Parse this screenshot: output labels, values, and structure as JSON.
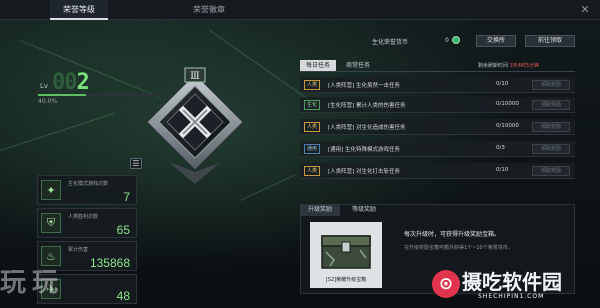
{
  "tabs": [
    {
      "label": "荣誉等级",
      "active": true
    },
    {
      "label": "荣誉徽章",
      "active": false
    }
  ],
  "level": {
    "prefix": "Lv",
    "value_dim": "00",
    "value_current": "2",
    "progress_text": "40.0%",
    "progress": 0.4
  },
  "stats": [
    {
      "label": "生化模式游戏次数",
      "value": "7",
      "icon": "crosshair-icon"
    },
    {
      "label": "人类胜利次数",
      "value": "65",
      "icon": "shield-icon"
    },
    {
      "label": "累计伤害",
      "value": "135868",
      "icon": "flame-icon"
    },
    {
      "label": "",
      "value": "48",
      "icon": "bird-icon"
    }
  ],
  "currency": {
    "label": "生化荣誉货币",
    "count": "0",
    "exchange_button": "交换所",
    "claim_button": "前往领取"
  },
  "task_tabs": [
    {
      "label": "每日任务",
      "active": true
    },
    {
      "label": "周常任务",
      "active": false
    }
  ],
  "refresh": {
    "text": "剩余刷新时间",
    "time": "3天4时5分钟"
  },
  "tasks": [
    {
      "tag": "人类",
      "tag_color": "orange",
      "desc": "[人类阵营] 生化虽然一击任务",
      "progress": "0/10",
      "claim": "领取奖励"
    },
    {
      "tag": "生化",
      "tag_color": "green",
      "desc": "[生化阵营] 累计人类的伤害任务",
      "progress": "0/10000",
      "claim": "领取奖励"
    },
    {
      "tag": "人类",
      "tag_color": "orange",
      "desc": "[人类阵营] 对生化造成伤害任务",
      "progress": "0/10000",
      "claim": "领取奖励"
    },
    {
      "tag": "通用",
      "tag_color": "blue",
      "desc": "[通用] 生化特殊模式游戏任务",
      "progress": "0/3",
      "claim": "领取奖励"
    },
    {
      "tag": "人类",
      "tag_color": "orange",
      "desc": "[人类阵营] 对生化打击斩任务",
      "progress": "0/10",
      "claim": "领取奖励"
    }
  ],
  "reward_tabs": [
    {
      "label": "升级奖励",
      "active": true
    },
    {
      "label": "等级奖励",
      "active": false
    }
  ],
  "reward": {
    "item_name": "[S2]荣耀升级宝箱",
    "note1": "每次升级时，可获得升级奖励宝箱。",
    "note2": "在升级奖励宝箱可额外获得1个~10个荣誉货币。"
  },
  "watermarks": {
    "left": "玩玩",
    "right_title": "摄吃软件园",
    "right_sub": "SHECHIPIN1.COM"
  },
  "colors": {
    "accent_green": "#79e07a",
    "tag_orange": "#e5c07a",
    "tag_green": "#8fd88f",
    "tag_blue": "#9cc2e8",
    "refresh_red": "#e25d58",
    "logo_red": "#e2344e"
  }
}
